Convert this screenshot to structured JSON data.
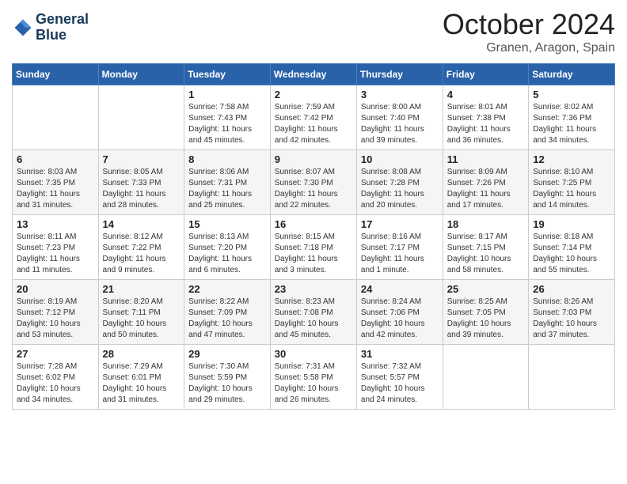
{
  "header": {
    "logo": {
      "line1": "General",
      "line2": "Blue"
    },
    "title": "October 2024",
    "location": "Granen, Aragon, Spain"
  },
  "columns": [
    "Sunday",
    "Monday",
    "Tuesday",
    "Wednesday",
    "Thursday",
    "Friday",
    "Saturday"
  ],
  "weeks": [
    [
      {
        "day": "",
        "sunrise": "",
        "sunset": "",
        "daylight": ""
      },
      {
        "day": "",
        "sunrise": "",
        "sunset": "",
        "daylight": ""
      },
      {
        "day": "1",
        "sunrise": "Sunrise: 7:58 AM",
        "sunset": "Sunset: 7:43 PM",
        "daylight": "Daylight: 11 hours and 45 minutes."
      },
      {
        "day": "2",
        "sunrise": "Sunrise: 7:59 AM",
        "sunset": "Sunset: 7:42 PM",
        "daylight": "Daylight: 11 hours and 42 minutes."
      },
      {
        "day": "3",
        "sunrise": "Sunrise: 8:00 AM",
        "sunset": "Sunset: 7:40 PM",
        "daylight": "Daylight: 11 hours and 39 minutes."
      },
      {
        "day": "4",
        "sunrise": "Sunrise: 8:01 AM",
        "sunset": "Sunset: 7:38 PM",
        "daylight": "Daylight: 11 hours and 36 minutes."
      },
      {
        "day": "5",
        "sunrise": "Sunrise: 8:02 AM",
        "sunset": "Sunset: 7:36 PM",
        "daylight": "Daylight: 11 hours and 34 minutes."
      }
    ],
    [
      {
        "day": "6",
        "sunrise": "Sunrise: 8:03 AM",
        "sunset": "Sunset: 7:35 PM",
        "daylight": "Daylight: 11 hours and 31 minutes."
      },
      {
        "day": "7",
        "sunrise": "Sunrise: 8:05 AM",
        "sunset": "Sunset: 7:33 PM",
        "daylight": "Daylight: 11 hours and 28 minutes."
      },
      {
        "day": "8",
        "sunrise": "Sunrise: 8:06 AM",
        "sunset": "Sunset: 7:31 PM",
        "daylight": "Daylight: 11 hours and 25 minutes."
      },
      {
        "day": "9",
        "sunrise": "Sunrise: 8:07 AM",
        "sunset": "Sunset: 7:30 PM",
        "daylight": "Daylight: 11 hours and 22 minutes."
      },
      {
        "day": "10",
        "sunrise": "Sunrise: 8:08 AM",
        "sunset": "Sunset: 7:28 PM",
        "daylight": "Daylight: 11 hours and 20 minutes."
      },
      {
        "day": "11",
        "sunrise": "Sunrise: 8:09 AM",
        "sunset": "Sunset: 7:26 PM",
        "daylight": "Daylight: 11 hours and 17 minutes."
      },
      {
        "day": "12",
        "sunrise": "Sunrise: 8:10 AM",
        "sunset": "Sunset: 7:25 PM",
        "daylight": "Daylight: 11 hours and 14 minutes."
      }
    ],
    [
      {
        "day": "13",
        "sunrise": "Sunrise: 8:11 AM",
        "sunset": "Sunset: 7:23 PM",
        "daylight": "Daylight: 11 hours and 11 minutes."
      },
      {
        "day": "14",
        "sunrise": "Sunrise: 8:12 AM",
        "sunset": "Sunset: 7:22 PM",
        "daylight": "Daylight: 11 hours and 9 minutes."
      },
      {
        "day": "15",
        "sunrise": "Sunrise: 8:13 AM",
        "sunset": "Sunset: 7:20 PM",
        "daylight": "Daylight: 11 hours and 6 minutes."
      },
      {
        "day": "16",
        "sunrise": "Sunrise: 8:15 AM",
        "sunset": "Sunset: 7:18 PM",
        "daylight": "Daylight: 11 hours and 3 minutes."
      },
      {
        "day": "17",
        "sunrise": "Sunrise: 8:16 AM",
        "sunset": "Sunset: 7:17 PM",
        "daylight": "Daylight: 11 hours and 1 minute."
      },
      {
        "day": "18",
        "sunrise": "Sunrise: 8:17 AM",
        "sunset": "Sunset: 7:15 PM",
        "daylight": "Daylight: 10 hours and 58 minutes."
      },
      {
        "day": "19",
        "sunrise": "Sunrise: 8:18 AM",
        "sunset": "Sunset: 7:14 PM",
        "daylight": "Daylight: 10 hours and 55 minutes."
      }
    ],
    [
      {
        "day": "20",
        "sunrise": "Sunrise: 8:19 AM",
        "sunset": "Sunset: 7:12 PM",
        "daylight": "Daylight: 10 hours and 53 minutes."
      },
      {
        "day": "21",
        "sunrise": "Sunrise: 8:20 AM",
        "sunset": "Sunset: 7:11 PM",
        "daylight": "Daylight: 10 hours and 50 minutes."
      },
      {
        "day": "22",
        "sunrise": "Sunrise: 8:22 AM",
        "sunset": "Sunset: 7:09 PM",
        "daylight": "Daylight: 10 hours and 47 minutes."
      },
      {
        "day": "23",
        "sunrise": "Sunrise: 8:23 AM",
        "sunset": "Sunset: 7:08 PM",
        "daylight": "Daylight: 10 hours and 45 minutes."
      },
      {
        "day": "24",
        "sunrise": "Sunrise: 8:24 AM",
        "sunset": "Sunset: 7:06 PM",
        "daylight": "Daylight: 10 hours and 42 minutes."
      },
      {
        "day": "25",
        "sunrise": "Sunrise: 8:25 AM",
        "sunset": "Sunset: 7:05 PM",
        "daylight": "Daylight: 10 hours and 39 minutes."
      },
      {
        "day": "26",
        "sunrise": "Sunrise: 8:26 AM",
        "sunset": "Sunset: 7:03 PM",
        "daylight": "Daylight: 10 hours and 37 minutes."
      }
    ],
    [
      {
        "day": "27",
        "sunrise": "Sunrise: 7:28 AM",
        "sunset": "Sunset: 6:02 PM",
        "daylight": "Daylight: 10 hours and 34 minutes."
      },
      {
        "day": "28",
        "sunrise": "Sunrise: 7:29 AM",
        "sunset": "Sunset: 6:01 PM",
        "daylight": "Daylight: 10 hours and 31 minutes."
      },
      {
        "day": "29",
        "sunrise": "Sunrise: 7:30 AM",
        "sunset": "Sunset: 5:59 PM",
        "daylight": "Daylight: 10 hours and 29 minutes."
      },
      {
        "day": "30",
        "sunrise": "Sunrise: 7:31 AM",
        "sunset": "Sunset: 5:58 PM",
        "daylight": "Daylight: 10 hours and 26 minutes."
      },
      {
        "day": "31",
        "sunrise": "Sunrise: 7:32 AM",
        "sunset": "Sunset: 5:57 PM",
        "daylight": "Daylight: 10 hours and 24 minutes."
      },
      {
        "day": "",
        "sunrise": "",
        "sunset": "",
        "daylight": ""
      },
      {
        "day": "",
        "sunrise": "",
        "sunset": "",
        "daylight": ""
      }
    ]
  ]
}
